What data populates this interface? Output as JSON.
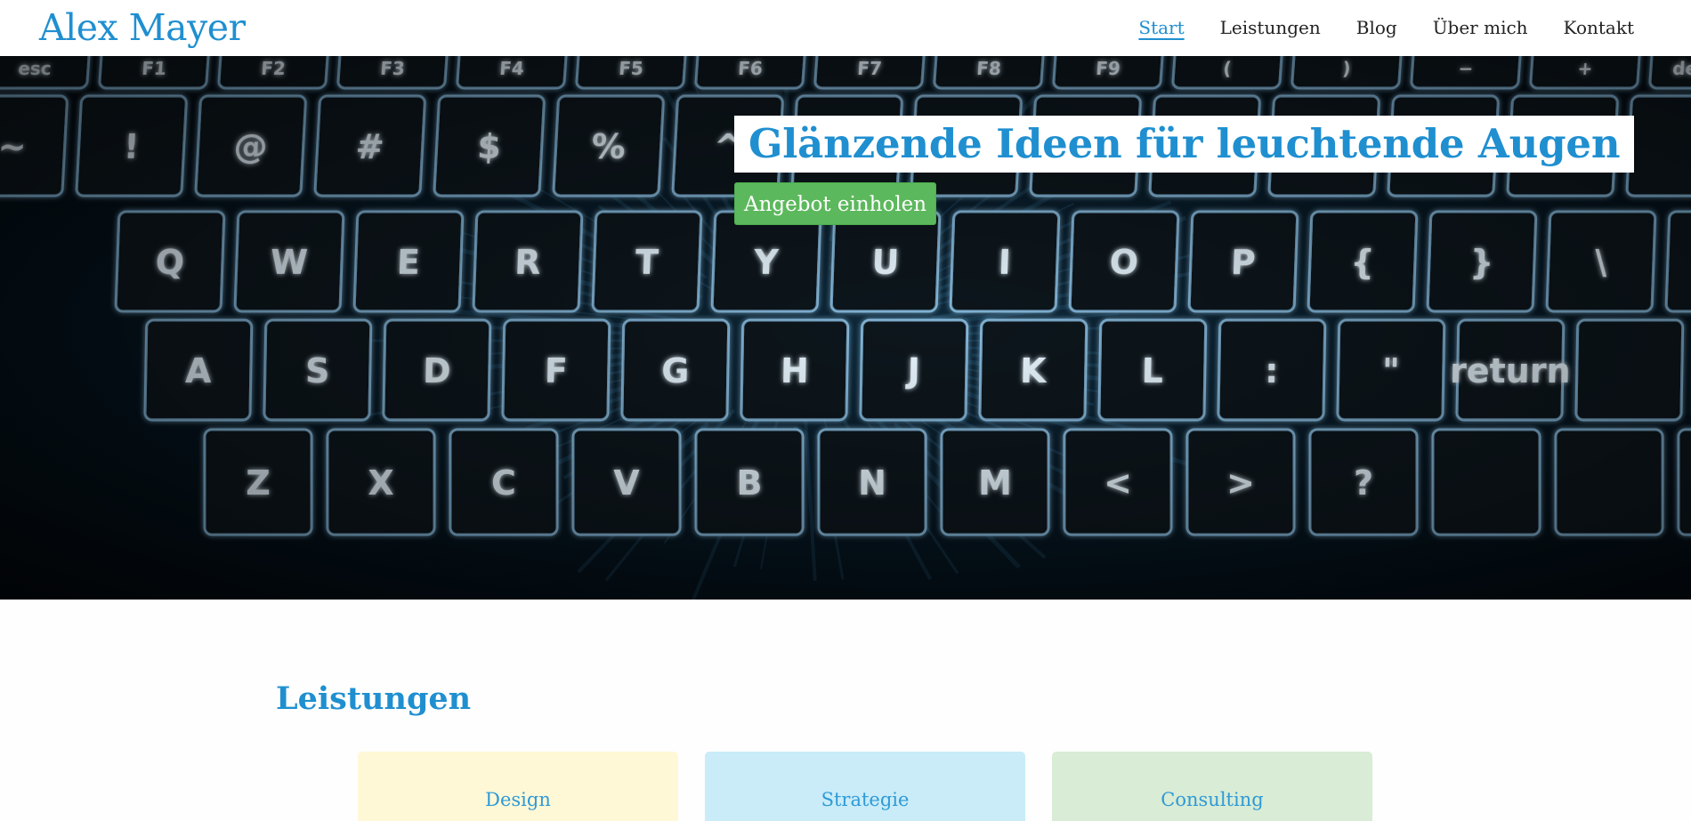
{
  "header": {
    "logo": "Alex Mayer",
    "nav": [
      {
        "label": "Start",
        "active": true
      },
      {
        "label": "Leistungen",
        "active": false
      },
      {
        "label": "Blog",
        "active": false
      },
      {
        "label": "Über mich",
        "active": false
      },
      {
        "label": "Kontakt",
        "active": false
      }
    ]
  },
  "hero": {
    "headline": "Glänzende Ideen für leuchtende Augen",
    "cta_label": "Angebot einholen",
    "key_rows": [
      [
        "esc",
        "F1",
        "F2",
        "F3",
        "F4",
        "F5",
        "F6",
        "F7",
        "F8",
        "F9",
        "(",
        ")",
        "−",
        "+",
        "delete"
      ],
      [
        "~",
        "!",
        "@",
        "#",
        "$",
        "%",
        "^",
        "&",
        "*",
        "(",
        ")",
        "_",
        "+"
      ],
      [
        "Q",
        "W",
        "E",
        "R",
        "T",
        "Y",
        "U",
        "I",
        "O",
        "P",
        "{",
        "}",
        "\\"
      ],
      [
        "A",
        "S",
        "D",
        "F",
        "G",
        "H",
        "J",
        "K",
        "L",
        ":",
        "\"",
        "return"
      ],
      [
        "Z",
        "X",
        "C",
        "V",
        "B",
        "N",
        "M",
        "<",
        ">",
        "?"
      ]
    ]
  },
  "services": {
    "title": "Leistungen",
    "cards": [
      {
        "label": "Design",
        "color": "#fff8d6"
      },
      {
        "label": "Strategie",
        "color": "#c9ecf8"
      },
      {
        "label": "Consulting",
        "color": "#d9ecd5"
      }
    ]
  },
  "colors": {
    "brand": "#1f8fd0",
    "cta": "#5cb85c",
    "key_glow": "#9fd8ff"
  }
}
